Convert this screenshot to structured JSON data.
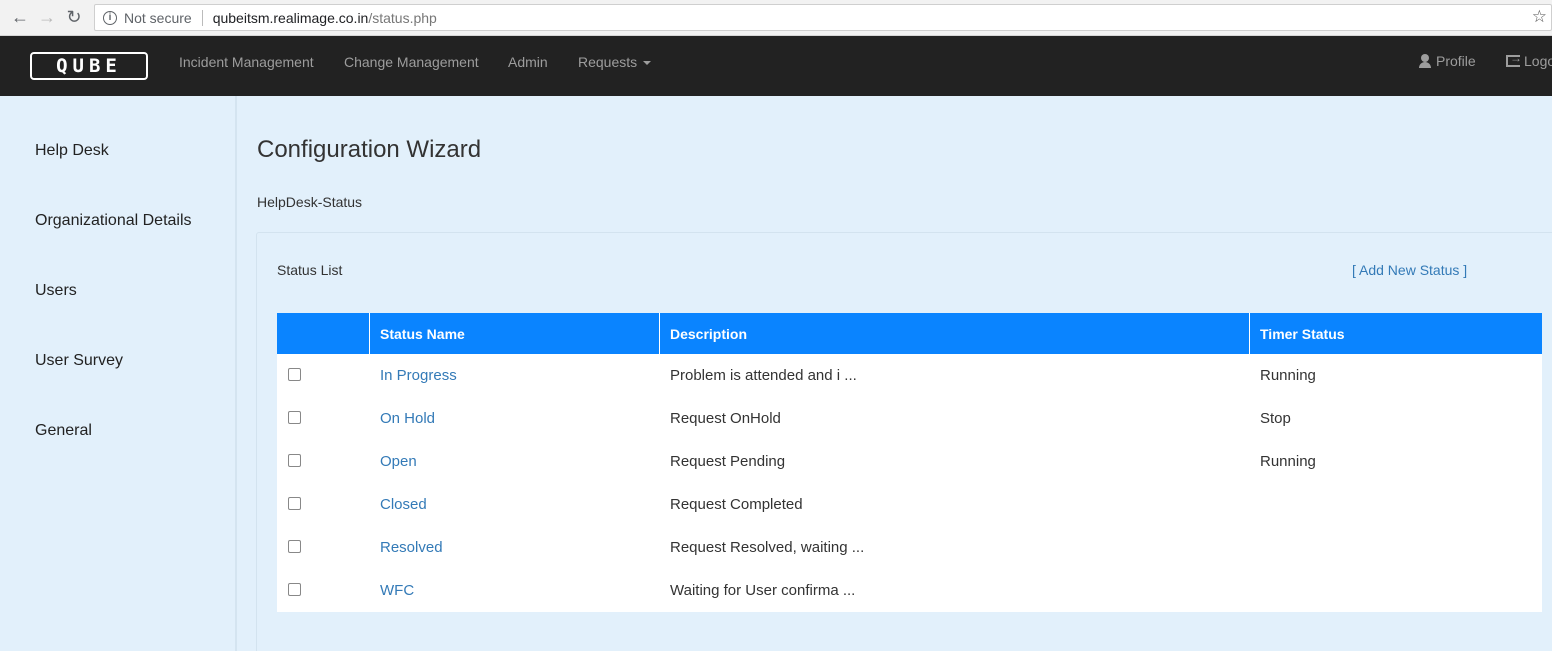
{
  "browser": {
    "security_label": "Not secure",
    "url_host": "qubeitsm.realimage.co.in",
    "url_path": "/status.php"
  },
  "navbar": {
    "logo": "QUBE",
    "items": [
      "Incident Management",
      "Change Management",
      "Admin",
      "Requests"
    ],
    "profile": "Profile",
    "logout": "Logo"
  },
  "sidebar": {
    "items": [
      "Help Desk",
      "Organizational Details",
      "Users",
      "User Survey",
      "General"
    ]
  },
  "main": {
    "title": "Configuration Wizard",
    "subtitle": "HelpDesk-Status",
    "panel_title": "Status List",
    "add_link": "[ Add New Status ]",
    "table": {
      "headers": [
        "",
        "Status Name",
        "Description",
        "Timer Status"
      ],
      "rows": [
        {
          "name": "In Progress",
          "description": "Problem is attended and i ...",
          "timer": "Running"
        },
        {
          "name": "On Hold",
          "description": "Request OnHold",
          "timer": "Stop"
        },
        {
          "name": "Open",
          "description": "Request Pending",
          "timer": "Running"
        },
        {
          "name": "Closed",
          "description": "Request Completed",
          "timer": ""
        },
        {
          "name": "Resolved",
          "description": "Request Resolved, waiting ...",
          "timer": ""
        },
        {
          "name": "WFC",
          "description": "Waiting for User confirma ...",
          "timer": ""
        }
      ]
    }
  },
  "colors": {
    "navbar": "#222222",
    "table_header": "#0a84ff",
    "link": "#337ab7",
    "background": "#e2f0fb"
  }
}
